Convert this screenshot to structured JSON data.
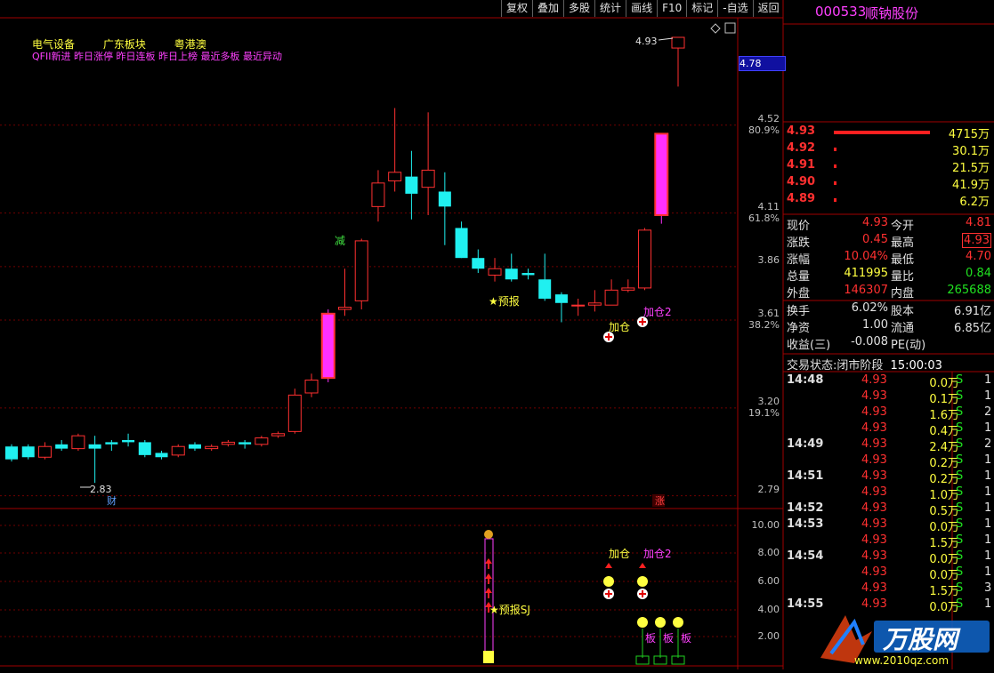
{
  "toolbar": {
    "items": [
      "复权",
      "叠加",
      "多股",
      "统计",
      "画线",
      "F10",
      "标记",
      "-自选",
      "返回"
    ]
  },
  "stock": {
    "code": "000533",
    "name": "顺钠股份"
  },
  "tags": {
    "line1": [
      "电气设备",
      "广东板块",
      "粤港澳"
    ],
    "line2": "QFII新进 昨日涨停 昨日连板 昨日上榜 最近多板 最近异动"
  },
  "price_axis": [
    {
      "price": "4.52",
      "pct": "80.9%"
    },
    {
      "price": "4.11",
      "pct": "61.8%"
    },
    {
      "price": "3.86",
      "pct": ""
    },
    {
      "price": "3.61",
      "pct": "38.2%"
    },
    {
      "price": "3.20",
      "pct": "19.1%"
    },
    {
      "price": "2.79",
      "pct": ""
    }
  ],
  "current_price_box": "4.78",
  "indicator_axis": [
    "10.00",
    "8.00",
    "6.00",
    "4.00",
    "2.00"
  ],
  "chart_marks": {
    "high_label": "4.93",
    "low_label": "2.83",
    "cai": "财",
    "zhang": "涨",
    "jian": "减",
    "yubao": "★预报",
    "jiacang": "加仓",
    "jiacang2": "加仓2",
    "yubao_sj": "★预报SJ",
    "jiacang_low": "加仓",
    "jiacang2_low": "加仓2",
    "ban": "板"
  },
  "chart_data": {
    "type": "candlestick",
    "candles": [
      {
        "o": 3.02,
        "c": 2.96,
        "h": 3.03,
        "l": 2.95
      },
      {
        "o": 3.02,
        "c": 2.97,
        "h": 3.03,
        "l": 2.96
      },
      {
        "o": 2.97,
        "c": 3.02,
        "h": 3.04,
        "l": 2.96
      },
      {
        "o": 3.03,
        "c": 3.01,
        "h": 3.05,
        "l": 3.0
      },
      {
        "o": 3.01,
        "c": 3.07,
        "h": 3.08,
        "l": 3.0
      },
      {
        "o": 3.03,
        "c": 3.01,
        "h": 3.07,
        "l": 2.85
      },
      {
        "o": 3.04,
        "c": 3.03,
        "h": 3.05,
        "l": 3.0
      },
      {
        "o": 3.05,
        "c": 3.04,
        "h": 3.08,
        "l": 3.02
      },
      {
        "o": 3.04,
        "c": 2.98,
        "h": 3.05,
        "l": 2.97
      },
      {
        "o": 2.99,
        "c": 2.97,
        "h": 3.0,
        "l": 2.96
      },
      {
        "o": 2.98,
        "c": 3.02,
        "h": 3.03,
        "l": 2.97
      },
      {
        "o": 3.03,
        "c": 3.01,
        "h": 3.04,
        "l": 3.0
      },
      {
        "o": 3.01,
        "c": 3.02,
        "h": 3.03,
        "l": 3.0
      },
      {
        "o": 3.03,
        "c": 3.04,
        "h": 3.05,
        "l": 3.02
      },
      {
        "o": 3.04,
        "c": 3.03,
        "h": 3.05,
        "l": 3.01
      },
      {
        "o": 3.03,
        "c": 3.06,
        "h": 3.07,
        "l": 3.02
      },
      {
        "o": 3.07,
        "c": 3.08,
        "h": 3.09,
        "l": 3.06
      },
      {
        "o": 3.09,
        "c": 3.26,
        "h": 3.29,
        "l": 3.08
      },
      {
        "o": 3.27,
        "c": 3.33,
        "h": 3.36,
        "l": 3.25
      },
      {
        "o": 3.34,
        "c": 3.64,
        "h": 3.66,
        "l": 3.32
      },
      {
        "o": 3.66,
        "c": 3.67,
        "h": 3.85,
        "l": 3.63
      },
      {
        "o": 3.7,
        "c": 3.98,
        "h": 3.99,
        "l": 3.66
      },
      {
        "o": 4.14,
        "c": 4.25,
        "h": 4.31,
        "l": 4.07
      },
      {
        "o": 4.26,
        "c": 4.3,
        "h": 4.6,
        "l": 4.21
      },
      {
        "o": 4.28,
        "c": 4.2,
        "h": 4.4,
        "l": 4.08
      },
      {
        "o": 4.23,
        "c": 4.31,
        "h": 4.58,
        "l": 4.1
      },
      {
        "o": 4.21,
        "c": 4.14,
        "h": 4.3,
        "l": 3.96
      },
      {
        "o": 4.04,
        "c": 3.9,
        "h": 4.07,
        "l": 3.9
      },
      {
        "o": 3.9,
        "c": 3.85,
        "h": 3.94,
        "l": 3.83
      },
      {
        "o": 3.82,
        "c": 3.85,
        "h": 3.9,
        "l": 3.79
      },
      {
        "o": 3.85,
        "c": 3.8,
        "h": 3.92,
        "l": 3.79
      },
      {
        "o": 3.83,
        "c": 3.82,
        "h": 3.85,
        "l": 3.8
      },
      {
        "o": 3.8,
        "c": 3.71,
        "h": 3.92,
        "l": 3.7
      },
      {
        "o": 3.73,
        "c": 3.69,
        "h": 3.74,
        "l": 3.6
      },
      {
        "o": 3.68,
        "c": 3.68,
        "h": 3.71,
        "l": 3.63
      },
      {
        "o": 3.68,
        "c": 3.69,
        "h": 3.75,
        "l": 3.65
      },
      {
        "o": 3.68,
        "c": 3.75,
        "h": 3.8,
        "l": 3.68
      },
      {
        "o": 3.75,
        "c": 3.76,
        "h": 3.8,
        "l": 3.74
      },
      {
        "o": 3.76,
        "c": 4.03,
        "h": 4.04,
        "l": 3.75
      },
      {
        "o": 4.1,
        "c": 4.48,
        "h": 4.48,
        "l": 4.06
      },
      {
        "o": 4.88,
        "c": 4.93,
        "h": 4.93,
        "l": 4.7
      }
    ],
    "ylim": [
      2.7,
      4.98
    ]
  },
  "orderbook": [
    {
      "price": "4.93",
      "vol": "4715万",
      "bar": 1.0
    },
    {
      "price": "4.92",
      "vol": "30.1万",
      "bar": 0.01
    },
    {
      "price": "4.91",
      "vol": "21.5万",
      "bar": 0.01
    },
    {
      "price": "4.90",
      "vol": "41.9万",
      "bar": 0.01
    },
    {
      "price": "4.89",
      "vol": "6.2万",
      "bar": 0.01
    }
  ],
  "quote": {
    "rows": [
      {
        "l1": "现价",
        "v1": "4.93",
        "c1": "#ff3030",
        "l2": "今开",
        "v2": "4.81",
        "c2": "#ff3030"
      },
      {
        "l1": "涨跌",
        "v1": "0.45",
        "c1": "#ff3030",
        "l2": "最高",
        "v2": "4.93",
        "c2": "#ff3030"
      },
      {
        "l1": "涨幅",
        "v1": "10.04%",
        "c1": "#ff3030",
        "l2": "最低",
        "v2": "4.70",
        "c2": "#ff3030"
      },
      {
        "l1": "总量",
        "v1": "411995",
        "c1": "#ffff40",
        "l2": "量比",
        "v2": "0.84",
        "c2": "#20e020"
      },
      {
        "l1": "外盘",
        "v1": "146307",
        "c1": "#ff3030",
        "l2": "内盘",
        "v2": "265688",
        "c2": "#20e020"
      },
      {
        "l1": "换手",
        "v1": "6.02%",
        "c1": "#e0e0e0",
        "l2": "股本",
        "v2": "6.91亿",
        "c2": "#e0e0e0"
      },
      {
        "l1": "净资",
        "v1": "1.00",
        "c1": "#e0e0e0",
        "l2": "流通",
        "v2": "6.85亿",
        "c2": "#e0e0e0"
      },
      {
        "l1": "收益(三)",
        "v1": "-0.008",
        "c1": "#e0e0e0",
        "l2": "PE(动)",
        "v2": "",
        "c2": "#e0e0e0"
      }
    ]
  },
  "status": {
    "label": "交易状态:",
    "phase": "闭市阶段",
    "time": "15:00:03"
  },
  "ticks": [
    {
      "t": "14:48",
      "p": "4.93",
      "v": "0.0万",
      "bs": "S",
      "n": "1"
    },
    {
      "t": "",
      "p": "4.93",
      "v": "0.1万",
      "bs": "S",
      "n": "1"
    },
    {
      "t": "",
      "p": "4.93",
      "v": "1.6万",
      "bs": "S",
      "n": "2"
    },
    {
      "t": "",
      "p": "4.93",
      "v": "0.4万",
      "bs": "S",
      "n": "1"
    },
    {
      "t": "14:49",
      "p": "4.93",
      "v": "2.4万",
      "bs": "S",
      "n": "2"
    },
    {
      "t": "",
      "p": "4.93",
      "v": "0.2万",
      "bs": "S",
      "n": "1"
    },
    {
      "t": "14:51",
      "p": "4.93",
      "v": "0.2万",
      "bs": "S",
      "n": "1"
    },
    {
      "t": "",
      "p": "4.93",
      "v": "1.0万",
      "bs": "S",
      "n": "1"
    },
    {
      "t": "14:52",
      "p": "4.93",
      "v": "0.5万",
      "bs": "S",
      "n": "1"
    },
    {
      "t": "14:53",
      "p": "4.93",
      "v": "0.0万",
      "bs": "S",
      "n": "1"
    },
    {
      "t": "",
      "p": "4.93",
      "v": "1.5万",
      "bs": "S",
      "n": "1"
    },
    {
      "t": "14:54",
      "p": "4.93",
      "v": "0.0万",
      "bs": "S",
      "n": "1"
    },
    {
      "t": "",
      "p": "4.93",
      "v": "0.0万",
      "bs": "S",
      "n": "1"
    },
    {
      "t": "",
      "p": "4.93",
      "v": "1.5万",
      "bs": "S",
      "n": "3"
    },
    {
      "t": "14:55",
      "p": "4.93",
      "v": "0.0万",
      "bs": "S",
      "n": "1"
    }
  ],
  "watermark": {
    "brand": "万股网",
    "url": "www.2010qz.com"
  }
}
